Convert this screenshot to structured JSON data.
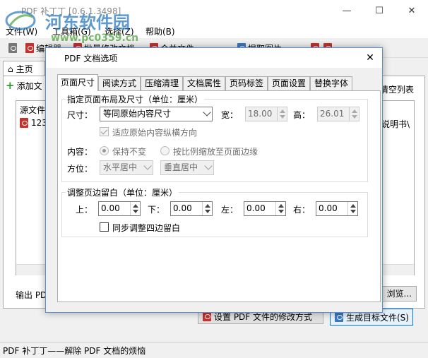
{
  "app": {
    "title": "PDF 补丁丁 [0.6.1.3498]",
    "window_controls": [
      "—",
      "☐",
      "✕"
    ]
  },
  "menu": [
    "文件(W)",
    "工具箱(G)",
    "选择(Z)",
    "帮助(B)"
  ],
  "toolbar": {
    "buttons": [
      "编辑器",
      "批量修改文档",
      "合并文件",
      "提取图片"
    ]
  },
  "main": {
    "home_tab": "主页",
    "add_file": "添加文",
    "clear_list": "清空列表",
    "source_column": "源文件",
    "file_name": "123",
    "readme_partial": "说明书\\",
    "output_label": "输出 PDF",
    "browse": "浏览...",
    "modify_button": "设置 PDF 文件的修改方式",
    "generate_button": "生成目标文件(S)"
  },
  "status": "PDF 补丁丁——解除 PDF 文档的烦恼",
  "watermark": {
    "text": "河东软件园",
    "url": "www.pc0359.cn"
  },
  "dialog": {
    "title": "PDF 文档选项",
    "close": "✕",
    "tabs": [
      "页面尺寸",
      "阅读方式",
      "压缩清理",
      "文档属性",
      "页码标签",
      "页面设置",
      "替换字体"
    ],
    "active_tab": 0,
    "size_group": {
      "legend": "指定页面布局及尺寸（单位：厘米）",
      "size_label": "尺寸：",
      "size_value": "等同原始内容尺寸",
      "width_label": "宽：",
      "width_value": "18.00",
      "height_label": "高：",
      "height_value": "26.01",
      "auto_rotate_label": "适应原始内容纵横方向",
      "content_label": "内容：",
      "keep_label": "保持不变",
      "scale_label": "按比例缩放至页面边缘",
      "position_label": "方位：",
      "h_align": "水平居中",
      "v_align": "垂直居中"
    },
    "margin_group": {
      "legend": "调整页边留白（单位：厘米）",
      "top_label": "上：",
      "top_value": "0.00",
      "bottom_label": "下：",
      "bottom_value": "0.00",
      "left_label": "左：",
      "left_value": "0.00",
      "right_label": "右：",
      "right_value": "0.00",
      "sync_label": "同步调整四边留白"
    }
  }
}
